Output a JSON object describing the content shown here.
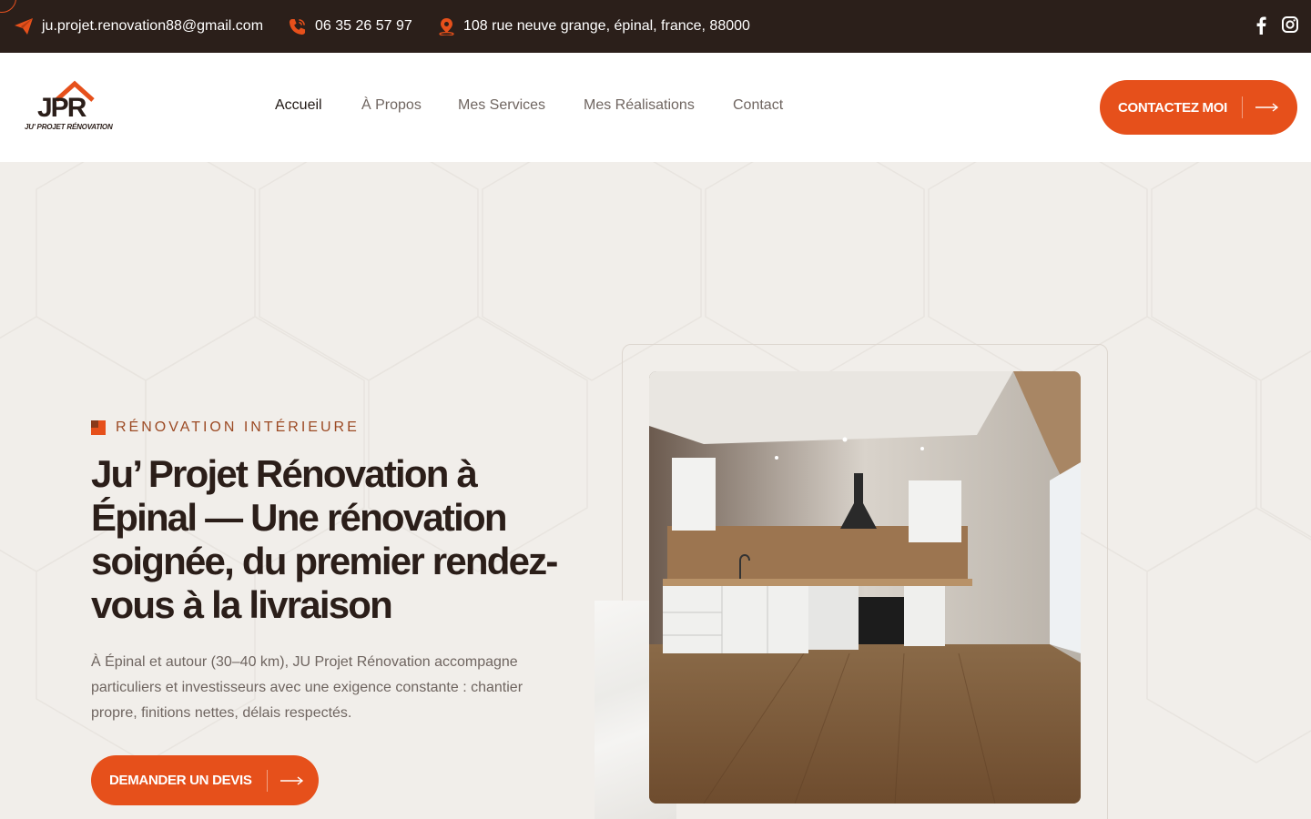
{
  "topbar": {
    "email": "ju.projet.renovation88@gmail.com",
    "phone": "06 35 26 57 97",
    "address": "108 rue neuve grange, épinal, france, 88000"
  },
  "logo": {
    "letters": "JPR",
    "tagline": "JU' PROJET RÉNOVATION"
  },
  "nav": {
    "items": [
      "Accueil",
      "À Propos",
      "Mes Services",
      "Mes Réalisations",
      "Contact"
    ],
    "active": "Accueil"
  },
  "header": {
    "cta_label": "CONTACTEZ MOI"
  },
  "hero": {
    "eyebrow": "RÉNOVATION INTÉRIEURE",
    "title": "Ju’ Projet Rénovation à Épinal — Une rénovation soignée, du premier rendez-vous à la livraison",
    "text": "À Épinal et autour (30–40 km), JU Projet Rénovation accompagne particuliers et investisseurs avec une exigence constante : chantier propre, finitions nettes, délais respectés.",
    "cta_label": "DEMANDER UN DEVIS"
  },
  "colors": {
    "accent": "#e6501b",
    "topbar_bg": "#2b1f1a",
    "page_bg": "#f1eeea",
    "heading": "#2b1e19"
  },
  "icons": {
    "email": "paper-plane-icon",
    "phone": "phone-icon",
    "address": "map-pin-icon",
    "facebook": "facebook-icon",
    "instagram": "instagram-icon",
    "arrow": "arrow-right-icon"
  }
}
